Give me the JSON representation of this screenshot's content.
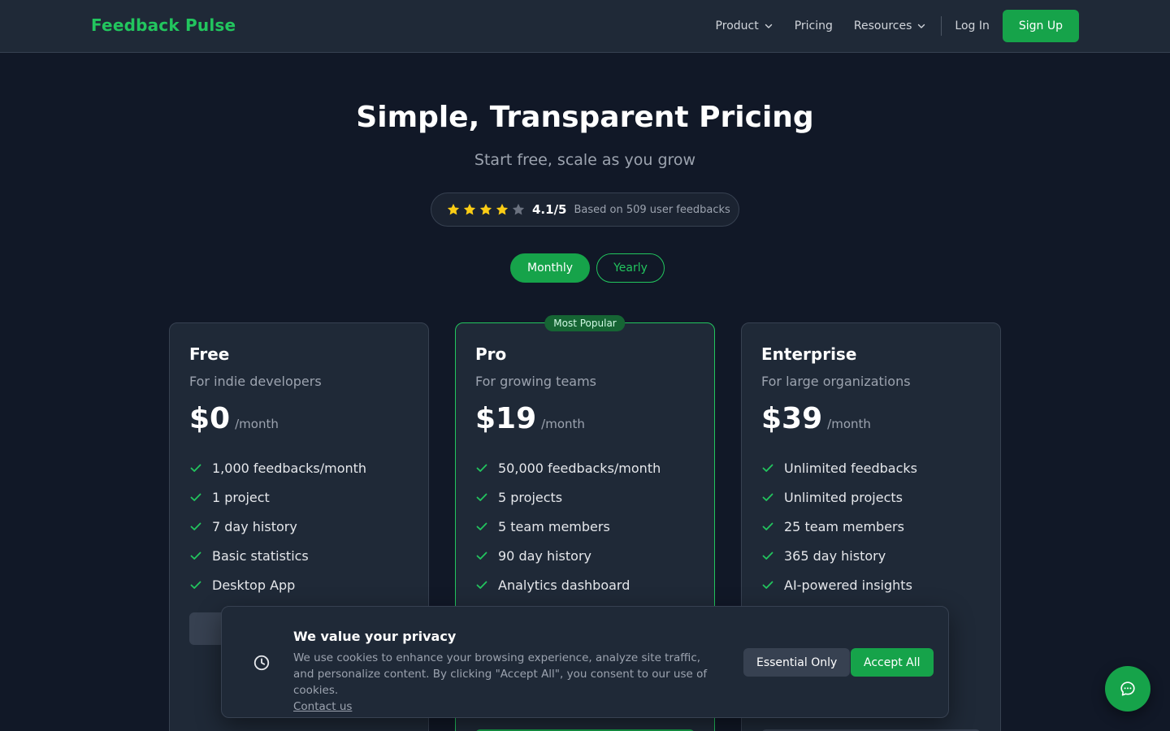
{
  "brand": {
    "name": "Feedback Pulse",
    "color": "#22c55e"
  },
  "nav": {
    "product": "Product",
    "pricing": "Pricing",
    "resources": "Resources",
    "login": "Log In",
    "signup": "Sign Up"
  },
  "hero": {
    "title": "Simple, Transparent Pricing",
    "subtitle": "Start free, scale as you grow"
  },
  "rating": {
    "stars_filled": 4,
    "stars_total": 5,
    "score": "4.1/5",
    "based_on": "Based on 509 user feedbacks"
  },
  "billing": {
    "monthly": "Monthly",
    "yearly": "Yearly",
    "selected": "Monthly"
  },
  "plans": [
    {
      "name": "Free",
      "description": "For indie developers",
      "price": "$0",
      "period": "/month",
      "features": [
        "1,000 feedbacks/month",
        "1 project",
        "7 day history",
        "Basic statistics",
        "Desktop App"
      ]
    },
    {
      "name": "Pro",
      "badge": "Most Popular",
      "description": "For growing teams",
      "price": "$19",
      "period": "/month",
      "features": [
        "50,000 feedbacks/month",
        "5 projects",
        "5 team members",
        "90 day history",
        "Analytics dashboard"
      ]
    },
    {
      "name": "Enterprise",
      "description": "For large organizations",
      "price": "$39",
      "period": "/month",
      "features": [
        "Unlimited feedbacks",
        "Unlimited projects",
        "25 team members",
        "365 day history",
        "AI-powered insights"
      ]
    }
  ],
  "cookie": {
    "title": "We value your privacy",
    "text": "We use cookies to enhance your browsing experience, analyze site traffic, and personalize content. By clicking \"Accept All\", you consent to our use of cookies.",
    "link": "Contact us",
    "essential": "Essential Only",
    "accept": "Accept All"
  },
  "icons": {
    "chevron": "chevron-down-icon",
    "star": "star-icon",
    "check": "check-icon",
    "cookie": "clock-icon",
    "chat": "chat-bubble-icon"
  },
  "colors": {
    "background": "#111827",
    "surface": "#1f2937",
    "accent": "#16a34a",
    "star": "#facc15",
    "star_empty": "#6b7280"
  }
}
